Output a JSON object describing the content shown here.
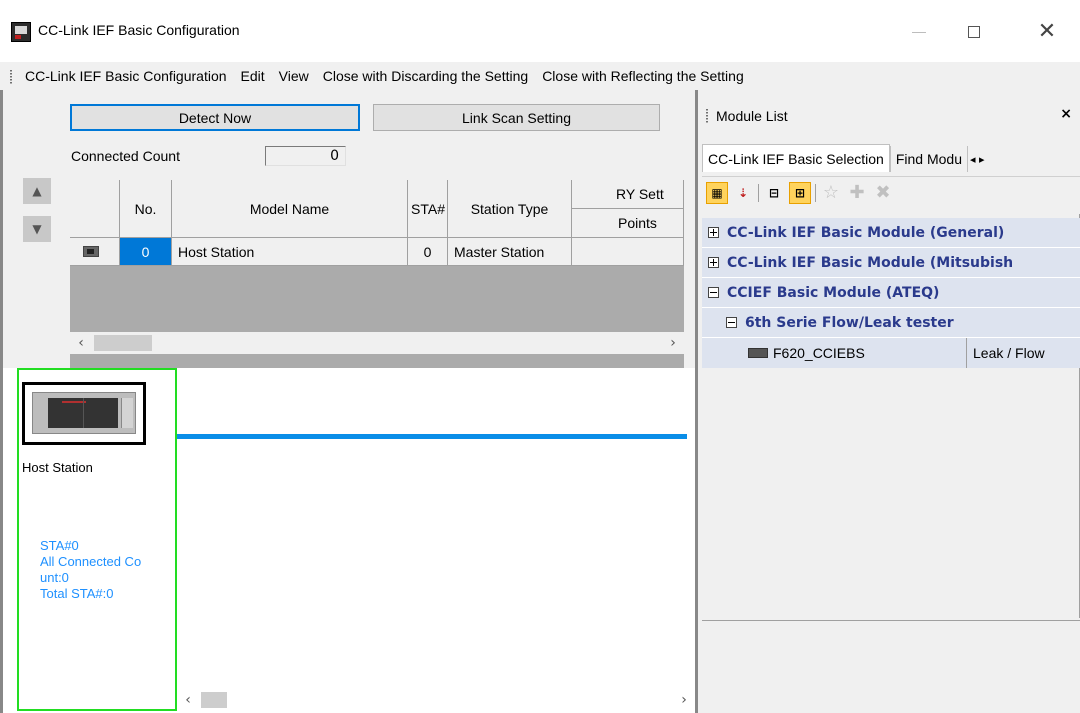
{
  "window": {
    "title": "CC-Link IEF Basic Configuration"
  },
  "menu": {
    "items": [
      "CC-Link IEF Basic Configuration",
      "Edit",
      "View",
      "Close with Discarding the Setting",
      "Close with Reflecting the Setting"
    ]
  },
  "toolbar": {
    "detect_label": "Detect Now",
    "link_scan_label": "Link Scan Setting",
    "connected_count_label": "Connected Count",
    "connected_count_value": "0"
  },
  "grid": {
    "headers": {
      "no": "No.",
      "model_name": "Model Name",
      "sta": "STA#",
      "station_type": "Station Type",
      "ry_setting": "RY Sett",
      "points": "Points"
    },
    "rows": [
      {
        "no": "0",
        "model_name": "Host Station",
        "sta": "0",
        "station_type": "Master Station",
        "points": ""
      }
    ]
  },
  "diagram": {
    "host_label": "Host Station",
    "info_lines": [
      "STA#0",
      "All Connected Co",
      "unt:0",
      "Total STA#:0"
    ]
  },
  "module_list": {
    "title": "Module List",
    "close_glyph": "×",
    "tabs": [
      "CC-Link IEF Basic Selection",
      "Find Modu"
    ],
    "tab_nav": "◂ ▸",
    "tree": [
      {
        "label": "CC-Link IEF Basic Module (General)",
        "expanded": false
      },
      {
        "label": "CC-Link IEF Basic Module (Mitsubish",
        "expanded": false
      },
      {
        "label": "CCIEF Basic Module (ATEQ)",
        "expanded": true
      },
      {
        "label": "6th Serie Flow/Leak tester",
        "expanded": true,
        "level": 1
      }
    ],
    "leaf": {
      "name": "F620_CCIEBS",
      "desc": "Leak / Flow"
    }
  },
  "colors": {
    "accent_blue": "#0078d7",
    "link_line": "#0a8ee8",
    "host_border": "#22dd22",
    "info_text": "#1e90ff",
    "tree_text": "#2a3a8c"
  }
}
